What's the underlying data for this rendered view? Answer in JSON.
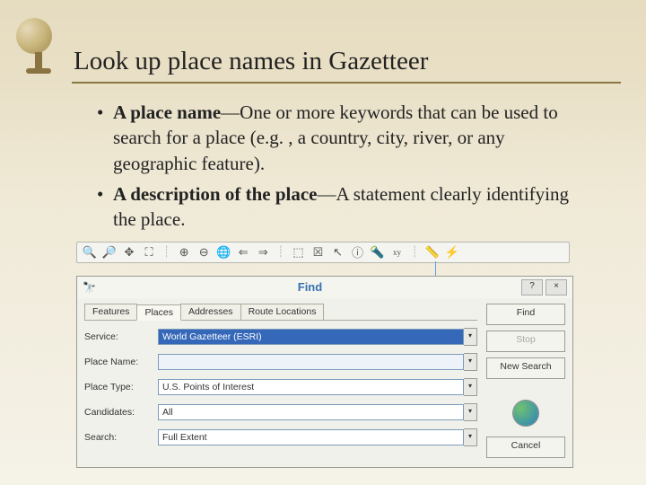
{
  "title": "Look up place names in Gazetteer",
  "bullets": [
    {
      "term": "A place name",
      "text": "—One or more keywords that can be used to search for a place (e.g. , a country, city, river, or any geographic feature)."
    },
    {
      "term": "A description of the place",
      "text": "—A statement clearly identifying the place."
    }
  ],
  "toolbar_icons": [
    "zoom-in",
    "zoom-out",
    "pan",
    "full-extent",
    "fixed-zoom-in",
    "fixed-zoom-out",
    "back",
    "forward",
    "select",
    "clear",
    "pointer",
    "identify",
    "find",
    "xy",
    "measure",
    "hyperlink"
  ],
  "dialog": {
    "title": "Find",
    "tabs": [
      "Features",
      "Places",
      "Addresses",
      "Route Locations"
    ],
    "active_tab": "Places",
    "fields": {
      "service_label": "Service:",
      "service_value": "World Gazetteer (ESRI)",
      "place_name_label": "Place Name:",
      "place_name_value": "",
      "place_type_label": "Place Type:",
      "place_type_value": "U.S. Points of Interest",
      "candidates_label": "Candidates:",
      "candidates_value": "All",
      "search_label": "Search:",
      "search_value": "Full Extent"
    },
    "buttons": {
      "find": "Find",
      "stop": "Stop",
      "new_search": "New Search",
      "cancel": "Cancel"
    }
  }
}
